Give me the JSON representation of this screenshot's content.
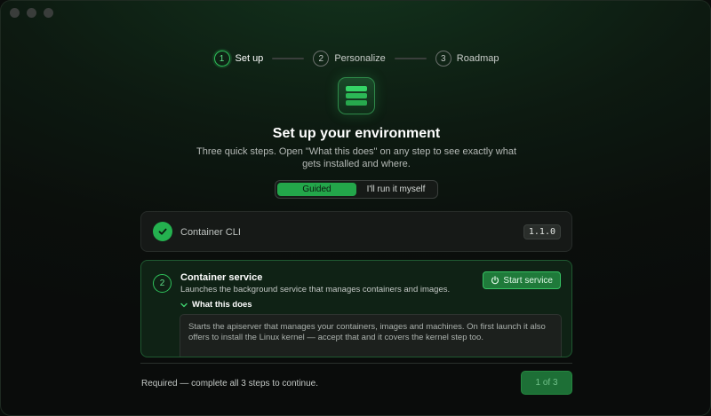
{
  "stepper": {
    "steps": [
      {
        "number": "1",
        "label": "Set up",
        "active": true
      },
      {
        "number": "2",
        "label": "Personalize",
        "active": false
      },
      {
        "number": "3",
        "label": "Roadmap",
        "active": false
      }
    ]
  },
  "header": {
    "title": "Set up your environment",
    "subtitle": "Three quick steps. Open \"What this does\" on any step to see exactly what gets installed and where."
  },
  "mode_toggle": {
    "options": [
      "Guided",
      "I'll run it myself"
    ],
    "selected": "Guided"
  },
  "steps": {
    "cli": {
      "name": "Container CLI",
      "version": "1.1.0",
      "status": "complete"
    },
    "service": {
      "number": "2",
      "title": "Container service",
      "description": "Launches the background service that manages containers and images.",
      "button_label": "Start service",
      "disclosure_label": "What this does",
      "details": "Starts the apiserver that manages your containers, images and machines. On first launch it also offers to install the Linux kernel — accept that and it covers the kernel step too."
    }
  },
  "footer": {
    "text": "Required — complete all 3 steps to continue.",
    "progress_label": "1 of 3"
  },
  "colors": {
    "accent": "#23a64a",
    "accent_bright": "#2fc25b",
    "background": "#0a0c0b"
  }
}
